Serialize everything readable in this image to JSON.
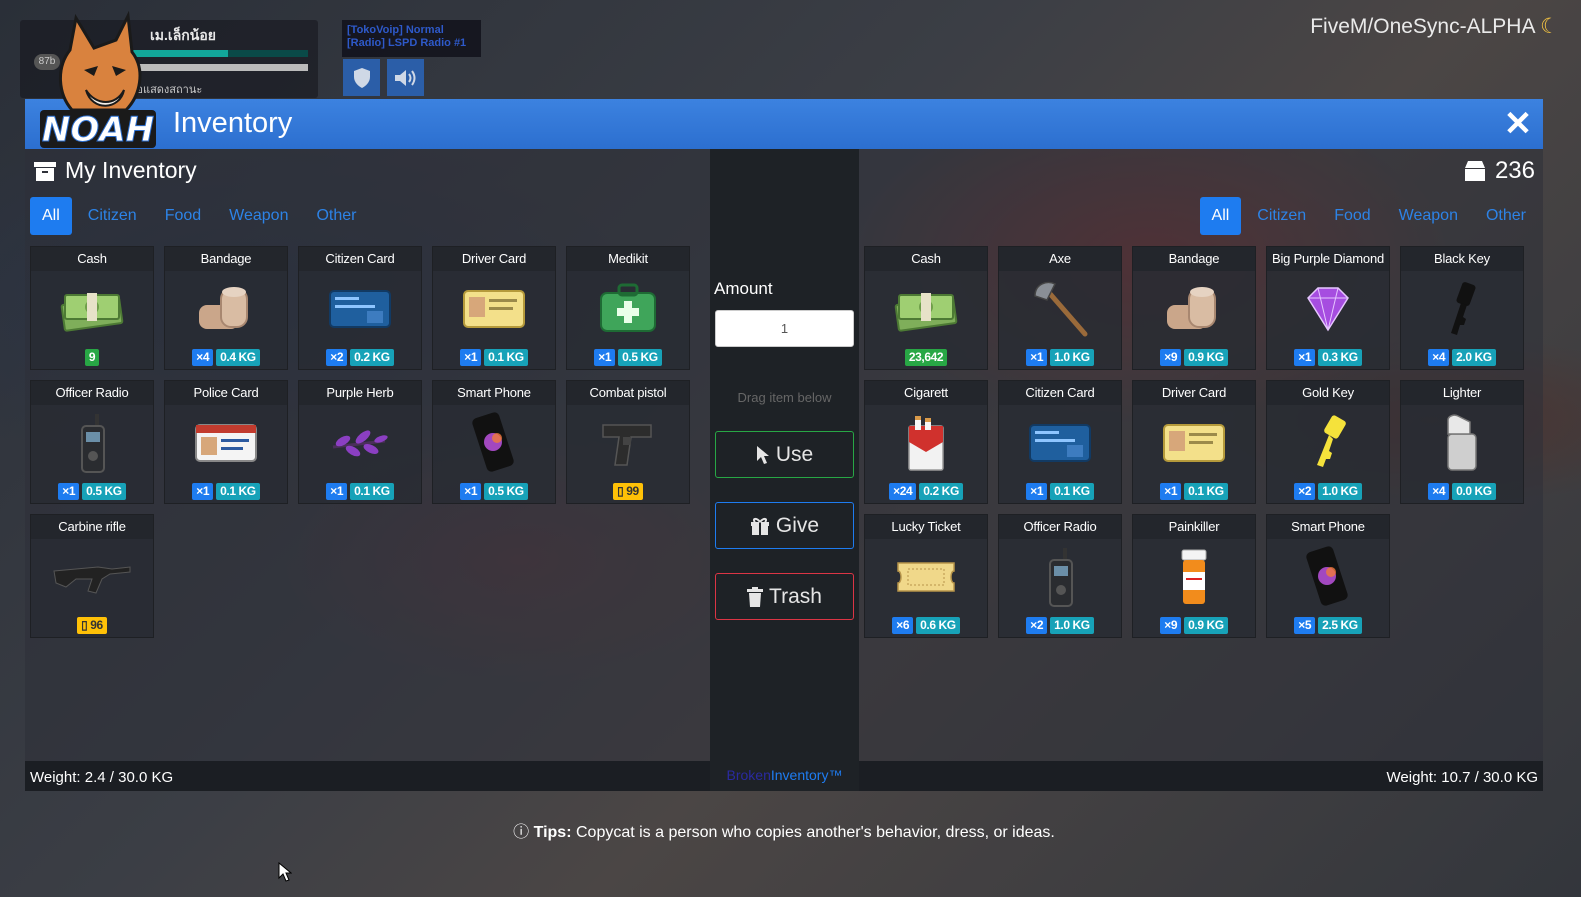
{
  "hud": {
    "player_name": "เม.เล็กน้อย",
    "hp": "87b",
    "status": "กด (↑) ค้างไว้เพื่อแสดงสถานะ",
    "radio_line1": "[TokoVoip] Normal",
    "radio_line2": "[Radio] LSPD Radio #1",
    "brand": "FiveM/OneSync-ALPHA",
    "brand_icon": "moon-icon"
  },
  "header": {
    "logo_text": "NOAH",
    "title": "Inventory",
    "close": "✕"
  },
  "my_inventory": {
    "title": "My Inventory",
    "weight": "Weight: 2.4 / 30.0 KG",
    "tabs": [
      "All",
      "Citizen",
      "Food",
      "Weapon",
      "Other"
    ],
    "active_tab": "All",
    "items": [
      {
        "name": "Cash",
        "icon": "money-icon",
        "cash": "9"
      },
      {
        "name": "Bandage",
        "icon": "bandage-icon",
        "qty": "×4",
        "weight": "0.4 KG"
      },
      {
        "name": "Citizen Card",
        "icon": "id-card-icon",
        "qty": "×2",
        "weight": "0.2 KG"
      },
      {
        "name": "Driver Card",
        "icon": "license-icon",
        "qty": "×1",
        "weight": "0.1 KG"
      },
      {
        "name": "Medikit",
        "icon": "medkit-icon",
        "qty": "×1",
        "weight": "0.5 KG"
      },
      {
        "name": "Officer Radio",
        "icon": "radio-icon",
        "qty": "×1",
        "weight": "0.5 KG"
      },
      {
        "name": "Police Card",
        "icon": "police-card-icon",
        "qty": "×1",
        "weight": "0.1 KG"
      },
      {
        "name": "Purple Herb",
        "icon": "herb-icon",
        "qty": "×1",
        "weight": "0.1 KG"
      },
      {
        "name": "Smart Phone",
        "icon": "phone-icon",
        "qty": "×1",
        "weight": "0.5 KG"
      },
      {
        "name": "Combat pistol",
        "icon": "pistol-icon",
        "ammo": "99"
      },
      {
        "name": "Carbine rifle",
        "icon": "rifle-icon",
        "ammo": "96"
      }
    ]
  },
  "middle": {
    "amount_label": "Amount",
    "amount_value": "1",
    "drag_hint": "Drag item below",
    "use": "Use",
    "give": "Give",
    "trash": "Trash",
    "credit_a": "Broken",
    "credit_b": "Inventory™"
  },
  "other_inventory": {
    "count": "236",
    "weight": "Weight: 10.7 / 30.0 KG",
    "tabs": [
      "All",
      "Citizen",
      "Food",
      "Weapon",
      "Other"
    ],
    "active_tab": "All",
    "items": [
      {
        "name": "Cash",
        "icon": "money-icon",
        "cash": "23,642"
      },
      {
        "name": "Axe",
        "icon": "axe-icon",
        "qty": "×1",
        "weight": "1.0 KG"
      },
      {
        "name": "Bandage",
        "icon": "bandage-icon",
        "qty": "×9",
        "weight": "0.9 KG"
      },
      {
        "name": "Big Purple Diamond",
        "icon": "diamond-icon",
        "qty": "×1",
        "weight": "0.3 KG"
      },
      {
        "name": "Black Key",
        "icon": "black-key-icon",
        "qty": "×4",
        "weight": "2.0 KG"
      },
      {
        "name": "Cigarett",
        "icon": "cigarette-pack-icon",
        "qty": "×24",
        "weight": "0.2 KG"
      },
      {
        "name": "Citizen Card",
        "icon": "id-card-icon",
        "qty": "×1",
        "weight": "0.1 KG"
      },
      {
        "name": "Driver Card",
        "icon": "license-icon",
        "qty": "×1",
        "weight": "0.1 KG"
      },
      {
        "name": "Gold Key",
        "icon": "gold-key-icon",
        "qty": "×2",
        "weight": "1.0 KG"
      },
      {
        "name": "Lighter",
        "icon": "lighter-icon",
        "qty": "×4",
        "weight": "0.0 KG"
      },
      {
        "name": "Lucky Ticket",
        "icon": "ticket-icon",
        "qty": "×6",
        "weight": "0.6 KG"
      },
      {
        "name": "Officer Radio",
        "icon": "radio-icon",
        "qty": "×2",
        "weight": "1.0 KG"
      },
      {
        "name": "Painkiller",
        "icon": "pill-bottle-icon",
        "qty": "×9",
        "weight": "0.9 KG"
      },
      {
        "name": "Smart Phone",
        "icon": "phone-icon",
        "qty": "×5",
        "weight": "2.5 KG"
      }
    ]
  },
  "tips": {
    "label": "Tips:",
    "text": "Copycat is a person who copies another's behavior, dress, or ideas."
  }
}
